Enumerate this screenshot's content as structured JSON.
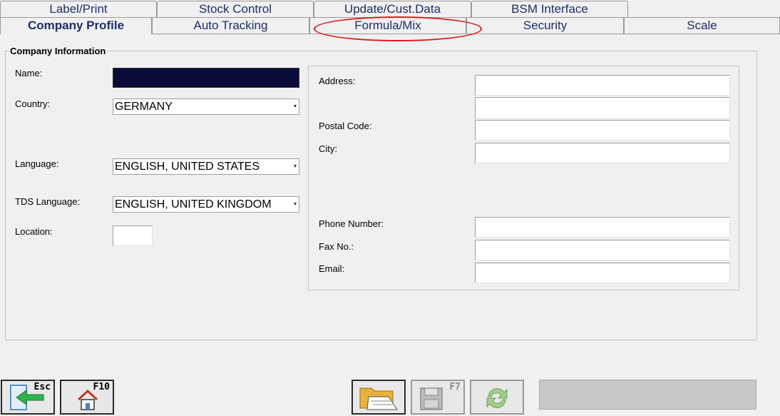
{
  "tabs": {
    "back_row": [
      {
        "label": "Label/Print"
      },
      {
        "label": "Stock Control"
      },
      {
        "label": "Update/Cust.Data"
      },
      {
        "label": "BSM Interface"
      }
    ],
    "front_row": [
      {
        "label": "Company Profile",
        "active": true
      },
      {
        "label": "Auto Tracking"
      },
      {
        "label": "Formula/Mix",
        "highlighted": true
      },
      {
        "label": "Security"
      },
      {
        "label": "Scale"
      }
    ]
  },
  "company_info": {
    "group_title": "Company Information",
    "name": {
      "label": "Name:",
      "value": ""
    },
    "country": {
      "label": "Country:",
      "value": "GERMANY"
    },
    "language": {
      "label": "Language:",
      "value": "ENGLISH, UNITED STATES"
    },
    "tds_language": {
      "label": "TDS Language:",
      "value": "ENGLISH, UNITED KINGDOM"
    },
    "location": {
      "label": "Location:",
      "value": ""
    },
    "address": {
      "label": "Address:",
      "line1": "",
      "line2": ""
    },
    "postal_code": {
      "label": "Postal Code:",
      "value": ""
    },
    "city": {
      "label": "City:",
      "value": ""
    },
    "phone": {
      "label": "Phone Number:",
      "value": ""
    },
    "fax": {
      "label": "Fax No.:",
      "value": ""
    },
    "email": {
      "label": "Email:",
      "value": ""
    }
  },
  "buttons": {
    "exit": {
      "key": "Esc",
      "icon": "exit-door-arrow-icon"
    },
    "home": {
      "key": "F10",
      "icon": "home-icon"
    },
    "open": {
      "key": "",
      "icon": "open-folder-icon"
    },
    "save": {
      "key": "F7",
      "icon": "floppy-disk-icon",
      "enabled": false
    },
    "refresh": {
      "key": "",
      "icon": "refresh-arrows-icon",
      "enabled": false
    }
  },
  "colors": {
    "tab_text": "#1c2f6b",
    "highlight_oval": "#e0191d",
    "name_field_bg": "#0b0b3a"
  }
}
